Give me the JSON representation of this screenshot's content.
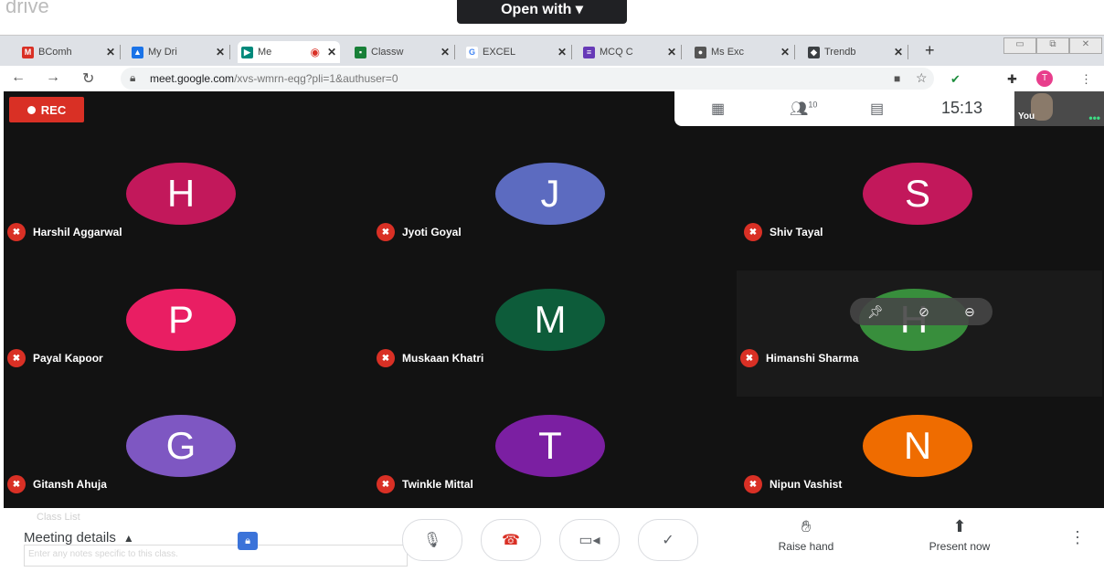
{
  "top": {
    "ghost_text": "drive",
    "open_with": "Open with ▾"
  },
  "tabs": [
    {
      "label": "BComh",
      "favicon": "gmail-icon",
      "color": "#d93025"
    },
    {
      "label": "My Dri",
      "favicon": "drive-icon",
      "color": "#1a73e8"
    },
    {
      "label": "Me",
      "favicon": "meet-icon",
      "color": "#00897b"
    },
    {
      "label": "Classw",
      "favicon": "classroom-icon",
      "color": "#188038"
    },
    {
      "label": "EXCEL",
      "favicon": "google-icon",
      "color": "#4285f4"
    },
    {
      "label": "MCQ C",
      "favicon": "forms-icon",
      "color": "#673ab7"
    },
    {
      "label": "Ms Exc",
      "favicon": "web-icon",
      "color": "#555555"
    },
    {
      "label": "Trendb",
      "favicon": "trend-icon",
      "color": "#3c4043"
    }
  ],
  "address": {
    "url_host": "meet.google.com",
    "url_path": "/xvs-wmrn-eqg?pli=1&authuser=0",
    "profile_initial": "T"
  },
  "meeting": {
    "rec_label": "REC",
    "participants_count": "10",
    "time": "15:13",
    "self_label": "You"
  },
  "participants": [
    {
      "initial": "H",
      "name": "Harshil Aggarwal",
      "color": "#c2185b"
    },
    {
      "initial": "J",
      "name": "Jyoti Goyal",
      "color": "#5c6bc0"
    },
    {
      "initial": "S",
      "name": "Shiv Tayal",
      "color": "#c2185b"
    },
    {
      "initial": "P",
      "name": "Payal Kapoor",
      "color": "#e91e63"
    },
    {
      "initial": "M",
      "name": "Muskaan Khatri",
      "color": "#0d5c3a"
    },
    {
      "initial": "H",
      "name": "Himanshi Sharma",
      "color": "#388e3c"
    },
    {
      "initial": "G",
      "name": "Gitansh Ahuja",
      "color": "#7e57c2"
    },
    {
      "initial": "T",
      "name": "Twinkle Mittal",
      "color": "#7b1fa2"
    },
    {
      "initial": "N",
      "name": "Nipun Vashist",
      "color": "#ef6c00"
    }
  ],
  "bottom": {
    "meeting_details": "Meeting details",
    "ghost_class_list": "Class List",
    "ghost_notes": "Enter any notes specific to this class.",
    "raise_hand": "Raise hand",
    "present_now": "Present now"
  }
}
